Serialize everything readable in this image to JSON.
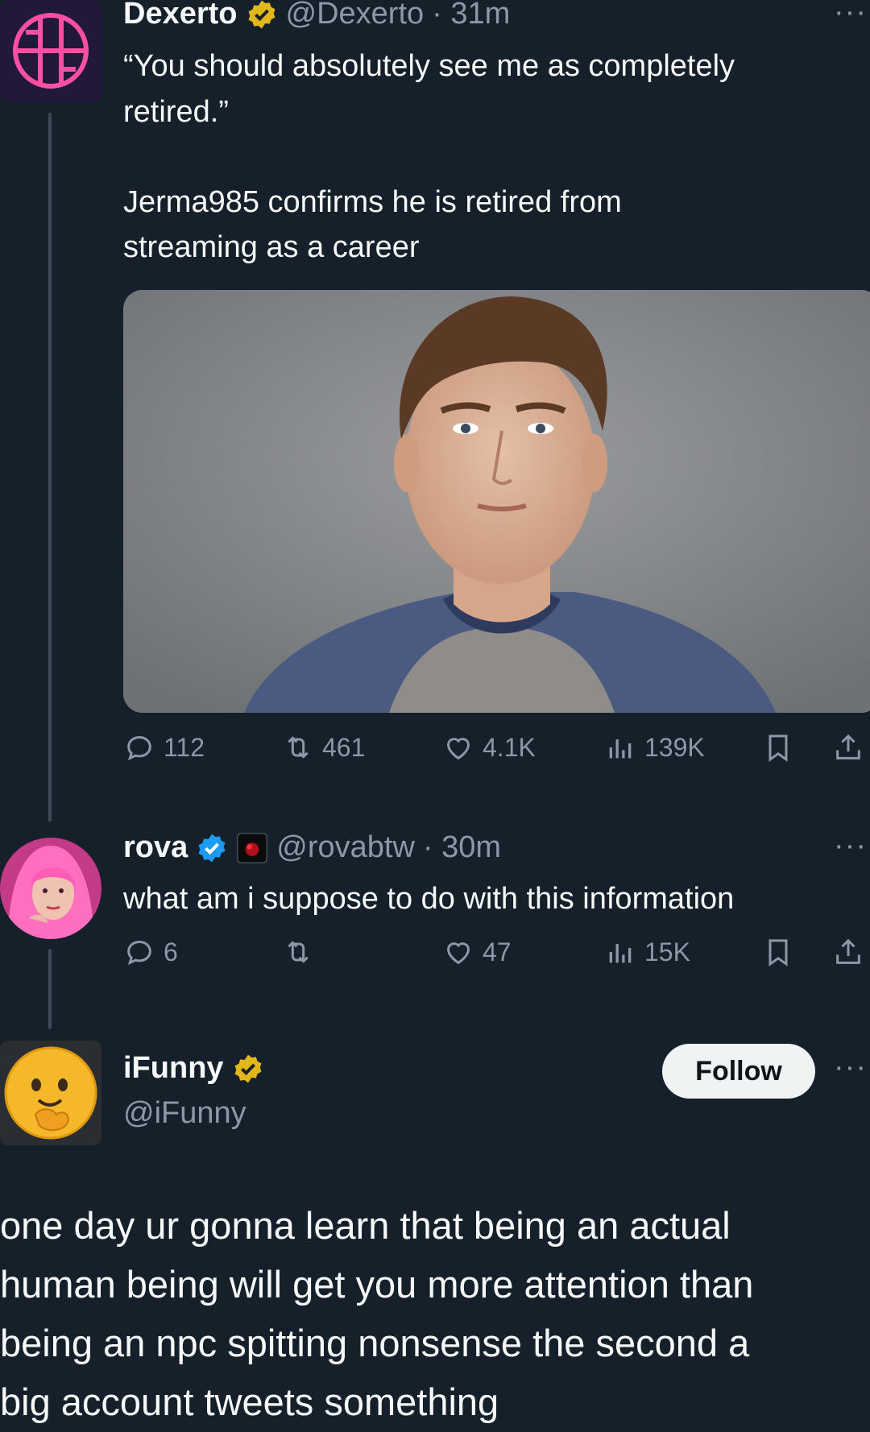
{
  "colors": {
    "background": "#15202b",
    "text": "#f7f9f9",
    "muted": "#8b98a5",
    "verified_gold": "#e2b719",
    "verified_blue": "#1d9bf0"
  },
  "tweet1": {
    "name": "Dexerto",
    "handle": "@Dexerto",
    "time": "· 31m",
    "more": "···",
    "text_line1": "“You should absolutely see me as completely",
    "text_line2": "retired.”",
    "text_line3": "Jerma985 confirms he is retired from",
    "text_line4": "streaming as a career",
    "actions": {
      "replies": "112",
      "reposts": "461",
      "likes": "4.1K",
      "views": "139K"
    }
  },
  "tweet2": {
    "name": "rova",
    "handle": "@rovabtw",
    "time": "· 30m",
    "more": "···",
    "text": "what am i suppose to do with this information",
    "actions": {
      "replies": "6",
      "reposts": "",
      "likes": "47",
      "views": "15K"
    }
  },
  "tweet3": {
    "name": "iFunny",
    "handle": "@iFunny",
    "follow_label": "Follow",
    "more": "···"
  },
  "caption": {
    "line1": "one day ur gonna learn that being an actual",
    "line2": "human being will get you more attention than",
    "line3": "being an npc spitting nonsense the second a",
    "line4": "big account tweets something"
  },
  "icons": [
    "reply-icon",
    "repost-icon",
    "like-icon",
    "views-icon",
    "bookmark-icon",
    "share-icon",
    "verified-gold-icon",
    "verified-blue-icon",
    "more-icon"
  ]
}
